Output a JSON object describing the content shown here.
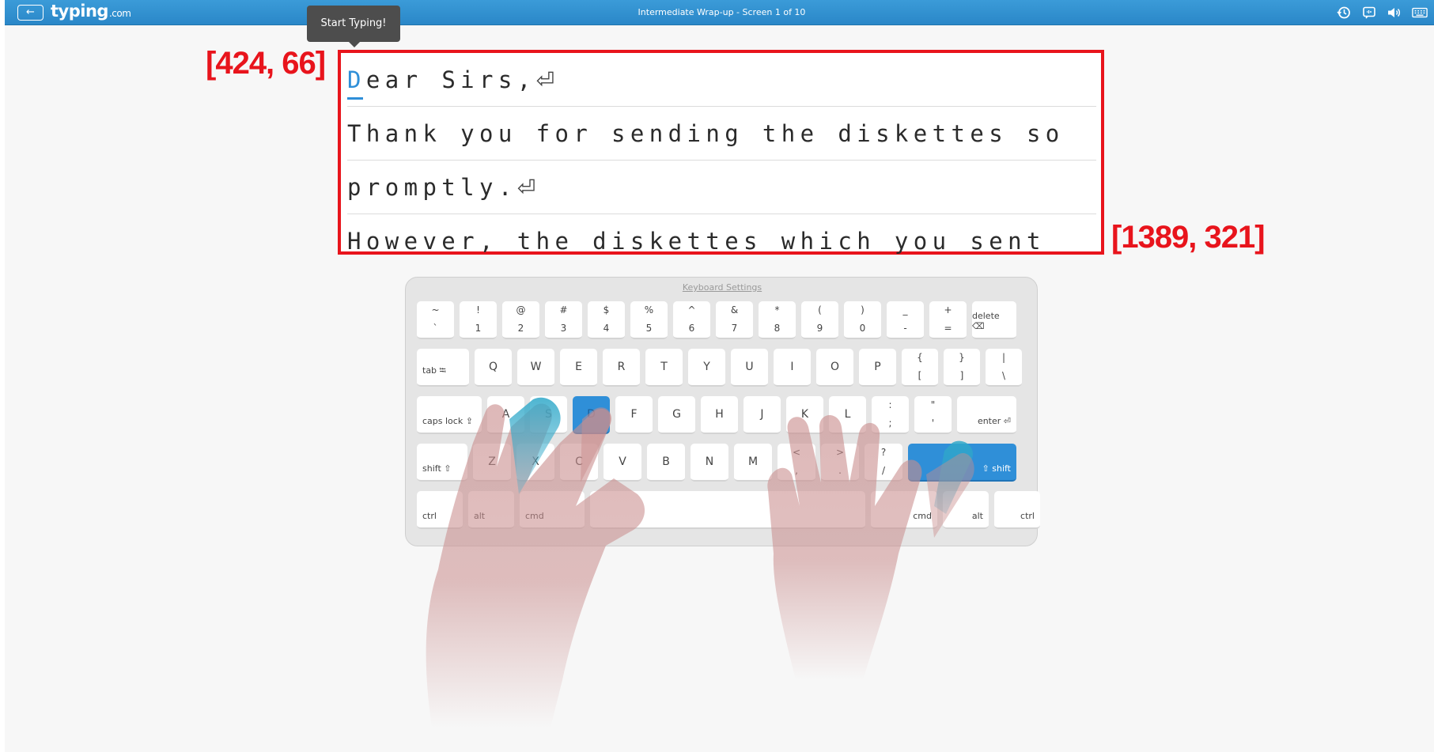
{
  "topbar": {
    "back_icon": "arrow-left-icon",
    "logo_main": "typing",
    "logo_tld": ".com",
    "title": "Intermediate Wrap-up - Screen 1 of 10",
    "icons": [
      "history-icon",
      "voice-icon",
      "volume-icon",
      "keyboard-icon"
    ]
  },
  "tooltip": {
    "text": "Start Typing!"
  },
  "annotations": {
    "top_left": "[424, 66]",
    "bottom_right": "[1389, 321]"
  },
  "text": {
    "cursor_char": "D",
    "lines": [
      "ear Sirs,",
      "Thank you for sending the diskettes so",
      "promptly.",
      "However, the diskettes which you sent"
    ],
    "return_symbol": "⏎"
  },
  "keyboard": {
    "settings_label": "Keyboard Settings",
    "active_keys": [
      "D",
      "shift-right"
    ],
    "rows": [
      [
        [
          "~",
          "`"
        ],
        [
          "!",
          "1"
        ],
        [
          "@",
          "2"
        ],
        [
          "#",
          "3"
        ],
        [
          "$",
          "4"
        ],
        [
          "%",
          "5"
        ],
        [
          "^",
          "6"
        ],
        [
          "&",
          "7"
        ],
        [
          "*",
          "8"
        ],
        [
          "(",
          "9"
        ],
        [
          ")",
          "0"
        ],
        [
          "_",
          "-"
        ],
        [
          "+",
          "="
        ]
      ],
      [
        "Q",
        "W",
        "E",
        "R",
        "T",
        "Y",
        "U",
        "I",
        "O",
        "P"
      ],
      [
        "A",
        "S",
        "D",
        "F",
        "G",
        "H",
        "J",
        "K",
        "L"
      ],
      [
        "Z",
        "X",
        "C",
        "V",
        "B",
        "N",
        "M"
      ]
    ],
    "row1_extra": [
      [
        "{",
        "["
      ],
      [
        "}",
        "]"
      ],
      [
        "|",
        "\\"
      ]
    ],
    "row2_extra": [
      [
        ":",
        ";"
      ],
      [
        "\"",
        "'"
      ]
    ],
    "row3_extra": [
      [
        "<",
        ","
      ],
      [
        ">",
        "."
      ],
      [
        "?",
        "/"
      ]
    ],
    "labels": {
      "delete": "delete ⌫",
      "tab": "tab ⭾",
      "caps": "caps lock ⇪",
      "enter": "enter ⏎",
      "shift_left": "shift ⇧",
      "shift_right": "⇧ shift",
      "ctrl": "ctrl",
      "alt": "alt",
      "cmd": "cmd"
    }
  }
}
